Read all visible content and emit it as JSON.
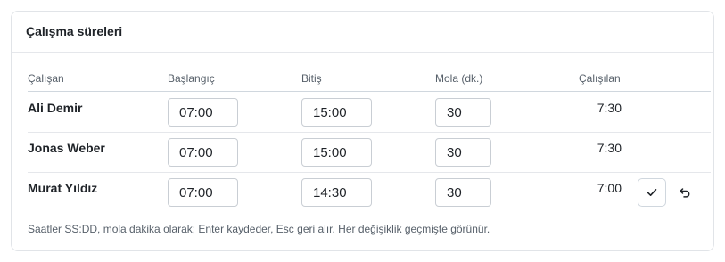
{
  "card": {
    "title": "Çalışma süreleri"
  },
  "table": {
    "headers": {
      "employee": "Çalışan",
      "start": "Başlangıç",
      "end": "Bitiş",
      "break": "Mola (dk.)",
      "worked": "Çalışılan"
    },
    "rows": [
      {
        "name": "Ali Demir",
        "start": "07:00",
        "end": "15:00",
        "break": "30",
        "worked": "7:30"
      },
      {
        "name": "Jonas Weber",
        "start": "07:00",
        "end": "15:00",
        "break": "30",
        "worked": "7:30"
      },
      {
        "name": "Murat Yıldız",
        "start": "07:00",
        "end": "14:30",
        "break": "30",
        "worked": "7:00"
      }
    ]
  },
  "actions": {
    "save_icon": "check-icon",
    "undo_icon": "undo-icon"
  },
  "hint": "Saatler SS:DD, mola dakika olarak; Enter kaydeder, Esc geri alır. Her değişiklik geçmişte görünür."
}
